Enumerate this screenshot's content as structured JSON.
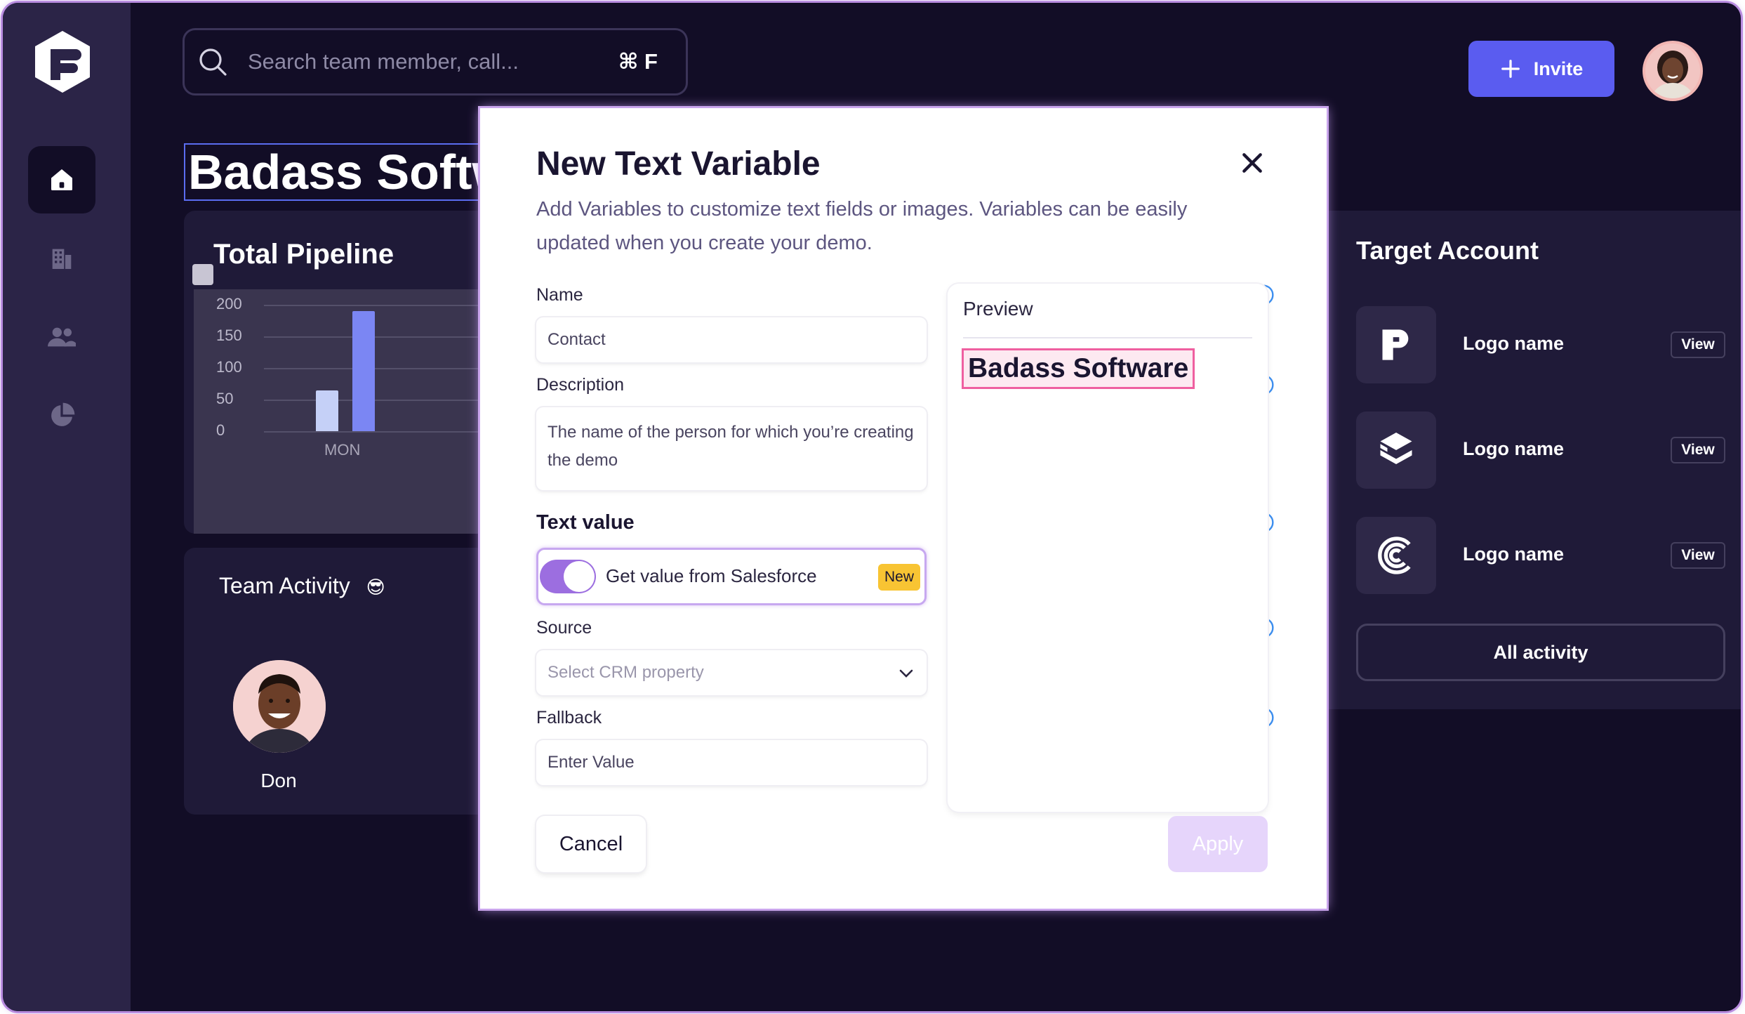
{
  "search": {
    "placeholder": "Search team member, call...",
    "shortcut": "⌘ F"
  },
  "header": {
    "invite_label": "Invite"
  },
  "page": {
    "title": "Badass Software"
  },
  "pipeline": {
    "title": "Total Pipeline",
    "chart_data": {
      "type": "bar",
      "categories": [
        "MON"
      ],
      "series": [
        {
          "values": [
            65
          ]
        },
        {
          "values": [
            190
          ]
        }
      ],
      "yticks": [
        "200",
        "150",
        "100",
        "50",
        "0"
      ],
      "ylim": [
        0,
        200
      ],
      "colors": [
        "#c5d0f7",
        "#7b86f3"
      ]
    }
  },
  "activity": {
    "title": "Team Activity",
    "emoji": "😎",
    "member": "Don"
  },
  "target": {
    "title": "Target Account",
    "accounts": [
      {
        "name": "Logo name",
        "view": "View"
      },
      {
        "name": "Logo name",
        "view": "View"
      },
      {
        "name": "Logo name",
        "view": "View"
      }
    ],
    "all_activity": "All activity"
  },
  "modal": {
    "title": "New Text Variable",
    "description": "Add Variables to customize text fields or images. Variables can be easily updated when you create your demo.",
    "name_label": "Name",
    "name_value": "Contact",
    "description_label": "Description",
    "description_value": "The name of the person for which you’re creating the demo",
    "text_value_label": "Text value",
    "salesforce_toggle": "Get value from Salesforce",
    "new_badge": "New",
    "source_label": "Source",
    "source_placeholder": "Select CRM property",
    "fallback_label": "Fallback",
    "fallback_placeholder": "Enter Value",
    "preview_label": "Preview",
    "preview_value": "Badass Software",
    "cancel": "Cancel",
    "apply": "Apply"
  },
  "colors": {
    "accent": "#5a5cf0",
    "background": "#120d26",
    "sidebar": "#2b2447",
    "toggle": "#9c6ee0",
    "badge": "#f8c433",
    "highlight": "#ef5fa0"
  }
}
